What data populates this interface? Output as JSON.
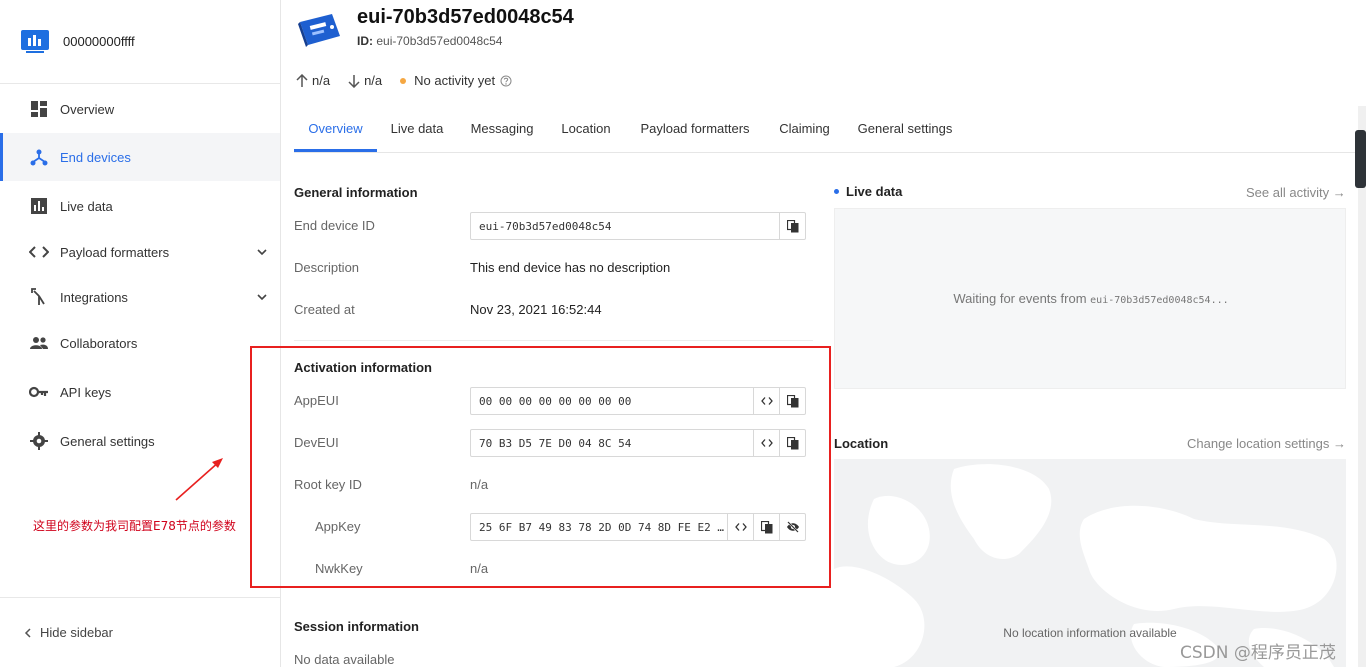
{
  "app": {
    "name": "00000000ffff"
  },
  "sidebar": {
    "items": [
      {
        "label": "Overview",
        "icon": "dashboard-icon"
      },
      {
        "label": "End devices",
        "icon": "device-hub-icon",
        "active": true
      },
      {
        "label": "Live data",
        "icon": "bar-chart-icon"
      },
      {
        "label": "Payload formatters",
        "icon": "code-icon",
        "expandable": true
      },
      {
        "label": "Integrations",
        "icon": "merge-icon",
        "expandable": true
      },
      {
        "label": "Collaborators",
        "icon": "people-icon"
      },
      {
        "label": "API keys",
        "icon": "key-icon"
      },
      {
        "label": "General settings",
        "icon": "gear-icon"
      }
    ],
    "hide_label": "Hide sidebar"
  },
  "annotation": {
    "text": "这里的参数为我司配置E78节点的参数"
  },
  "device": {
    "title": "eui-70b3d57ed0048c54",
    "id_label": "ID:",
    "id_value": "eui-70b3d57ed0048c54",
    "uplink": "n/a",
    "downlink": "n/a",
    "activity": "No activity yet"
  },
  "tabs": [
    "Overview",
    "Live data",
    "Messaging",
    "Location",
    "Payload formatters",
    "Claiming",
    "General settings"
  ],
  "general": {
    "title": "General information",
    "end_device_id_label": "End device ID",
    "end_device_id": "eui-70b3d57ed0048c54",
    "description_label": "Description",
    "description": "This end device has no description",
    "created_label": "Created at",
    "created": "Nov 23, 2021 16:52:44"
  },
  "activation": {
    "title": "Activation information",
    "appeui_label": "AppEUI",
    "appeui": "00 00 00 00 00 00 00 00",
    "deveui_label": "DevEUI",
    "deveui": "70 B3 D5 7E D0 04 8C 54",
    "root_key_label": "Root key ID",
    "root_key": "n/a",
    "appkey_label": "AppKey",
    "appkey": "25 6F B7 49 83 78 2D 0D 74 8D FE E2 0…",
    "nwkkey_label": "NwkKey",
    "nwkkey": "n/a"
  },
  "session": {
    "title": "Session information",
    "empty": "No data available"
  },
  "live": {
    "title": "Live data",
    "see_all": "See all activity →",
    "waiting_prefix": "Waiting for events from ",
    "waiting_id": "eui-70b3d57ed0048c54..."
  },
  "location": {
    "title": "Location",
    "settings": "Change location settings →",
    "empty": "No location information available"
  },
  "watermark": "CSDN @程序员正茂",
  "colors": {
    "accent": "#2a6ee8",
    "annotation": "#e8201f",
    "activity_dot": "#f5a742"
  }
}
